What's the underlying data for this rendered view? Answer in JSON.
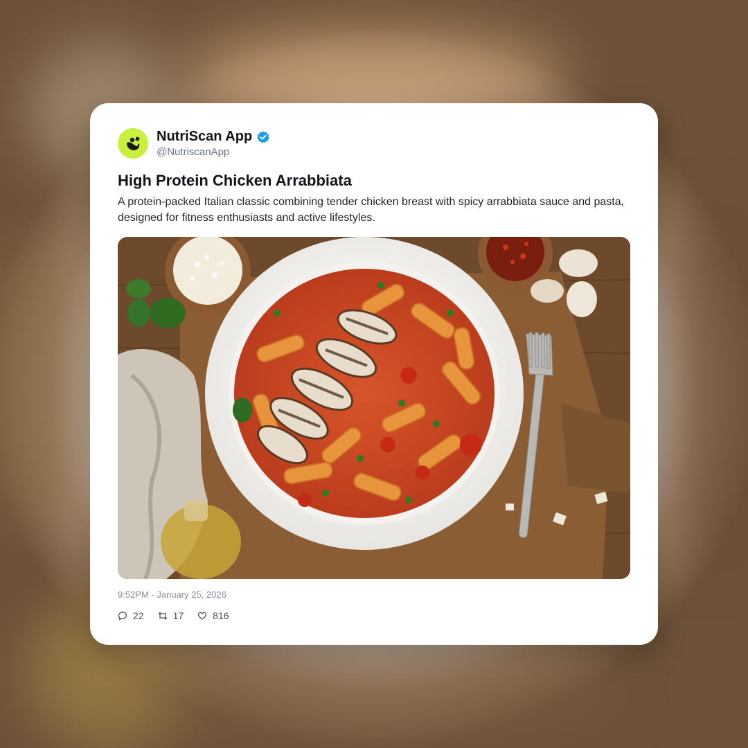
{
  "post": {
    "display_name": "NutriScan App",
    "handle": "@NutriscanApp",
    "verified": true,
    "title": "High Protein Chicken Arrabbiata",
    "description": "A protein-packed Italian classic combining tender chicken breast with spicy arrabbiata sauce and pasta, designed for fitness enthusiasts and active lifestyles.",
    "timestamp": "9:52PM - January 25, 2026",
    "replies": "22",
    "reposts": "17",
    "likes": "816"
  },
  "colors": {
    "avatar_bg": "#c8f03c",
    "verified_badge": "#1d9bf0",
    "card_bg": "#ffffff"
  },
  "icons": {
    "avatar": "nutriscan-logo-icon",
    "verified": "verified-badge-icon",
    "reply": "reply-icon",
    "repost": "repost-icon",
    "like": "heart-icon"
  }
}
